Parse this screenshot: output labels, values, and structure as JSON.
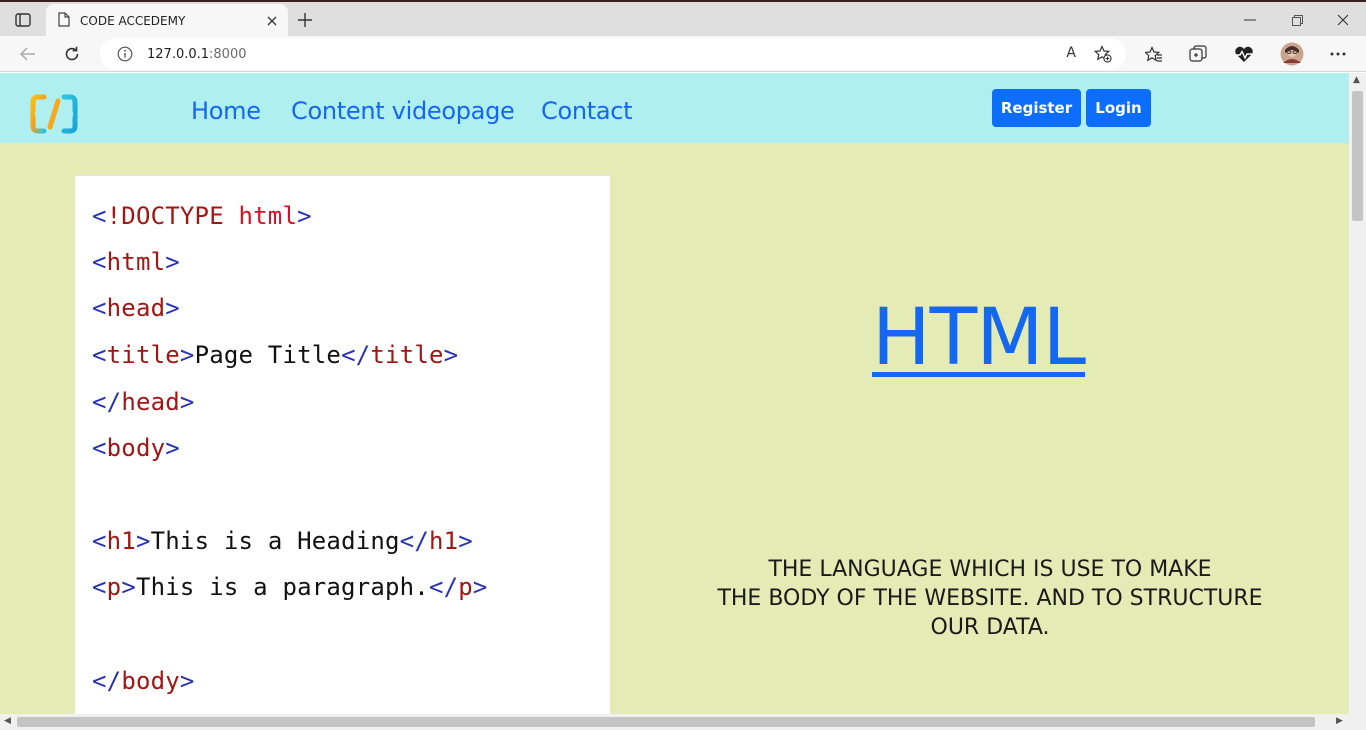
{
  "browser": {
    "tab": {
      "title": "CODE ACCEDEMY"
    },
    "address": {
      "host": "127.0.0.1",
      "port": ":8000"
    },
    "read_aloud_label": "A"
  },
  "nav": {
    "links": [
      {
        "label": "Home"
      },
      {
        "label": "Content videopage"
      },
      {
        "label": "Contact"
      }
    ],
    "register_label": "Register",
    "login_label": "Login"
  },
  "code_sample": {
    "lines": [
      {
        "open": "<",
        "name": "!DOCTYPE",
        "kw": " html",
        "close": ">"
      },
      {
        "open": "<",
        "name": "html",
        "close": ">"
      },
      {
        "open": "<",
        "name": "head",
        "close": ">"
      },
      {
        "open": "<",
        "name": "title",
        "close": ">",
        "text": "Page Title",
        "open2": "</",
        "name2": "title",
        "close2": ">"
      },
      {
        "open": "</",
        "name": "head",
        "close": ">"
      },
      {
        "open": "<",
        "name": "body",
        "close": ">"
      },
      {
        "open": "<",
        "name": "h1",
        "close": ">",
        "text": "This is a Heading",
        "open2": "</",
        "name2": "h1",
        "close2": ">"
      },
      {
        "open": "<",
        "name": "p",
        "close": ">",
        "text": "This is a paragraph.",
        "open2": "</",
        "name2": "p",
        "close2": ">"
      },
      {
        "open": "</",
        "name": "body",
        "close": ">"
      }
    ]
  },
  "hero": {
    "title": "HTML",
    "description": [
      "THE LANGUAGE WHICH IS USE TO MAKE",
      "THE BODY OF THE WEBSITE. AND TO STRUCTURE",
      "OUR DATA."
    ]
  },
  "colors": {
    "nav_bg": "#afeff0",
    "page_bg": "#e4ebb4",
    "link": "#1467f0",
    "button": "#0d6efd"
  }
}
